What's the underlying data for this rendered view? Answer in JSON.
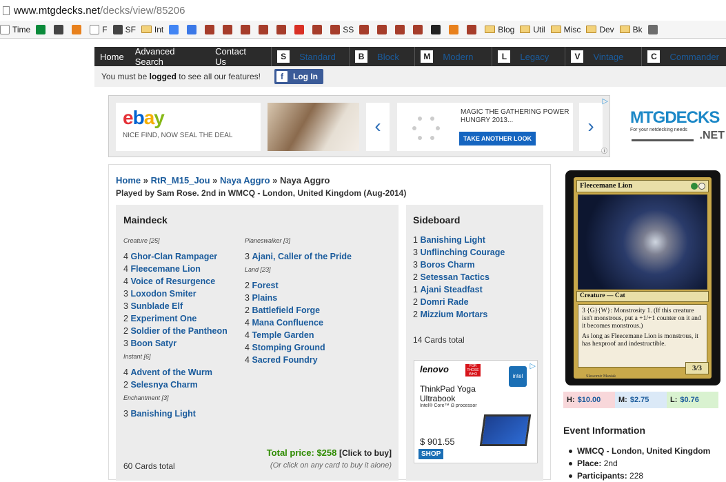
{
  "browser": {
    "url_host": "www.mtgdecks.net",
    "url_path": "/decks/view/85206",
    "bookmarks": [
      {
        "label": "Time",
        "icon": "page-icon"
      },
      {
        "label": "",
        "icon": "k-icon"
      },
      {
        "label": "",
        "icon": "bookmark-icon"
      },
      {
        "label": "",
        "icon": "stack-icon"
      },
      {
        "label": "F",
        "icon": "page-icon"
      },
      {
        "label": "SF",
        "icon": "bookmark-icon"
      },
      {
        "label": "Int",
        "icon": "folder-icon"
      },
      {
        "label": "",
        "icon": "google-icon"
      },
      {
        "label": "",
        "icon": "calendar-icon"
      },
      {
        "label": "",
        "icon": "site-icon"
      },
      {
        "label": "",
        "icon": "site-icon"
      },
      {
        "label": "",
        "icon": "site-icon"
      },
      {
        "label": "",
        "icon": "site-icon"
      },
      {
        "label": "",
        "icon": "site-icon"
      },
      {
        "label": "",
        "icon": "gmail-icon"
      },
      {
        "label": "",
        "icon": "site-icon"
      },
      {
        "label": "SS",
        "icon": "site-icon"
      },
      {
        "label": "",
        "icon": "site-icon"
      },
      {
        "label": "",
        "icon": "site-icon"
      },
      {
        "label": "",
        "icon": "site-icon"
      },
      {
        "label": "",
        "icon": "site-icon"
      },
      {
        "label": "",
        "icon": "amazon-icon"
      },
      {
        "label": "",
        "icon": "stack-icon"
      },
      {
        "label": "",
        "icon": "site-icon"
      },
      {
        "label": "Blog",
        "icon": "folder-icon"
      },
      {
        "label": "Util",
        "icon": "folder-icon"
      },
      {
        "label": "Misc",
        "icon": "folder-icon"
      },
      {
        "label": "Dev",
        "icon": "folder-icon"
      },
      {
        "label": "Bk",
        "icon": "folder-icon"
      },
      {
        "label": "",
        "icon": "tn-icon"
      }
    ]
  },
  "nav": {
    "home": "Home",
    "advanced_search": "Advanced Search",
    "contact": "Contact Us",
    "formats": [
      {
        "key": "S",
        "label": "Standard"
      },
      {
        "key": "B",
        "label": "Block"
      },
      {
        "key": "M",
        "label": "Modern"
      },
      {
        "key": "L",
        "label": "Legacy"
      },
      {
        "key": "V",
        "label": "Vintage"
      },
      {
        "key": "C",
        "label": "Commander"
      }
    ]
  },
  "login_bar": {
    "pre": "You must be ",
    "bold": "logged",
    "post": " to see all our features!",
    "button": "Log In"
  },
  "ad_banner": {
    "ebay_logo": "ebay",
    "ebay_tagline": "NICE FIND, NOW SEAL THE DEAL",
    "mtg_text": "MAGIC THE GATHERING POWER HUNGRY 2013...",
    "mtg_cta": "TAKE ANOTHER LOOK",
    "prev": "‹",
    "next": "›"
  },
  "site_logo": {
    "name": "MTGDECKS",
    "tagline": "For your netdecking needs",
    "tld": ".NET"
  },
  "deck": {
    "breadcrumb": [
      {
        "label": "Home",
        "link": true
      },
      {
        "label": "RtR_M15_Jou",
        "link": true
      },
      {
        "label": "Naya Aggro",
        "link": true
      },
      {
        "label": "Naya Aggro",
        "link": false
      }
    ],
    "played_by": "Played by Sam Rose. 2nd in WMCQ - London, United Kingdom (Aug-2014)",
    "maindeck_title": "Maindeck",
    "sideboard_title": "Sideboard",
    "col1": [
      {
        "category": "Creature [25]",
        "cards": [
          {
            "qty": "4",
            "name": "Ghor-Clan Rampager"
          },
          {
            "qty": "4",
            "name": "Fleecemane Lion"
          },
          {
            "qty": "4",
            "name": "Voice of Resurgence"
          },
          {
            "qty": "3",
            "name": "Loxodon Smiter"
          },
          {
            "qty": "3",
            "name": "Sunblade Elf"
          },
          {
            "qty": "2",
            "name": "Experiment One"
          },
          {
            "qty": "2",
            "name": "Soldier of the Pantheon"
          },
          {
            "qty": "3",
            "name": "Boon Satyr"
          }
        ]
      },
      {
        "category": "Instant [6]",
        "cards": [
          {
            "qty": "4",
            "name": "Advent of the Wurm"
          },
          {
            "qty": "2",
            "name": "Selesnya Charm"
          }
        ]
      },
      {
        "category": "Enchantment [3]",
        "cards": [
          {
            "qty": "3",
            "name": "Banishing Light"
          }
        ]
      }
    ],
    "col2": [
      {
        "category": "Planeswalker [3]",
        "cards": [
          {
            "qty": "3",
            "name": "Ajani, Caller of the Pride"
          }
        ]
      },
      {
        "category": "Land [23]",
        "cards": [
          {
            "qty": "2",
            "name": "Forest"
          },
          {
            "qty": "3",
            "name": "Plains"
          },
          {
            "qty": "2",
            "name": "Battlefield Forge"
          },
          {
            "qty": "4",
            "name": "Mana Confluence"
          },
          {
            "qty": "4",
            "name": "Temple Garden"
          },
          {
            "qty": "4",
            "name": "Stomping Ground"
          },
          {
            "qty": "4",
            "name": "Sacred Foundry"
          }
        ]
      }
    ],
    "sideboard": [
      {
        "qty": "1",
        "name": "Banishing Light"
      },
      {
        "qty": "3",
        "name": "Unflinching Courage"
      },
      {
        "qty": "3",
        "name": "Boros Charm"
      },
      {
        "qty": "2",
        "name": "Setessan Tactics"
      },
      {
        "qty": "1",
        "name": "Ajani Steadfast"
      },
      {
        "qty": "2",
        "name": "Domri Rade"
      },
      {
        "qty": "2",
        "name": "Mizzium Mortars"
      }
    ],
    "sideboard_total": "14 Cards total",
    "maindeck_total": "60 Cards total",
    "total_price_label": "Total price:",
    "total_price": "$258",
    "click_to_buy": "[Click to buy]",
    "alt_buy": "(Or click on any card to buy it alone)"
  },
  "side_ad": {
    "brand": "lenovo",
    "ribbon": "FOR THOSE WHO DO.",
    "intel": "intel",
    "product": "ThinkPad Yoga Ultrabook",
    "processor": "Intel® Core™ i3 processor",
    "price": "$ 901.55",
    "shop": "SHOP"
  },
  "card": {
    "name": "Fleecemane Lion",
    "type": "Creature — Cat",
    "rules_1": "3 {G}{W}: Monstrosity 1. (If this creature isn't monstrous, put a +1/+1 counter on it and it becomes monstrous.)",
    "rules_2": "As long as Fleecemane Lion is monstrous, it has hexproof and indestructible.",
    "pt": "3/3",
    "artist": "Slawomir Maniak",
    "mana_colors": [
      "#2e8b3a",
      "#f2efe1"
    ]
  },
  "prices": {
    "high_label": "H:",
    "high": "$10.00",
    "mid_label": "M:",
    "mid": "$2.75",
    "low_label": "L:",
    "low": "$0.76",
    "colors": {
      "high": "#f8d7da",
      "mid": "#dbe9f7",
      "low": "#d9f2d0"
    }
  },
  "event": {
    "title": "Event Information",
    "name": "WMCQ - London, United Kingdom",
    "place_label": "Place:",
    "place": "2nd",
    "participants_label": "Participants:",
    "participants": "228"
  },
  "colors": {
    "link": "#1a5b9c",
    "nav_bg": "#2b2b2b",
    "price_green": "#2e8b00",
    "fb_blue": "#3b5b98"
  }
}
